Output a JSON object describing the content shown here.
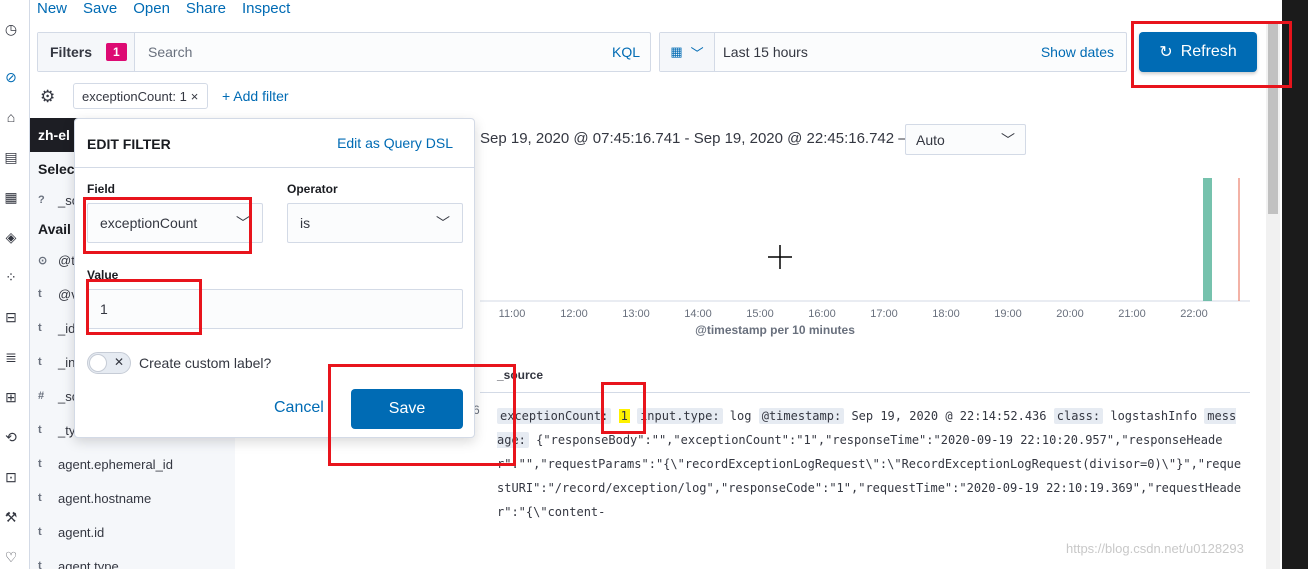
{
  "top_menu": [
    "New",
    "Save",
    "Open",
    "Share",
    "Inspect"
  ],
  "query_bar": {
    "filters_label": "Filters",
    "filter_count": "1",
    "search_placeholder": "Search",
    "language": "KQL"
  },
  "date_picker": {
    "range": "Last 15 hours",
    "show_dates": "Show dates"
  },
  "refresh_label": "Refresh",
  "filter_bar": {
    "pill_label": "exceptionCount: 1",
    "add_filter": "+ Add filter"
  },
  "sidebar": {
    "index_pattern": "zh-el",
    "selected_heading": "Selec",
    "available_heading": "Avail",
    "fields": [
      {
        "type": "?",
        "name": "_sc"
      },
      {
        "type": "⊙",
        "name": "@t"
      },
      {
        "type": "t",
        "name": "@v"
      },
      {
        "type": "t",
        "name": "_id"
      },
      {
        "type": "t",
        "name": "_in"
      },
      {
        "type": "#",
        "name": "_sc"
      },
      {
        "type": "t",
        "name": "_ty"
      },
      {
        "type": "t",
        "name": "agent.ephemeral_id"
      },
      {
        "type": "t",
        "name": "agent.hostname"
      },
      {
        "type": "t",
        "name": "agent.id"
      },
      {
        "type": "t",
        "name": "agent.type"
      }
    ]
  },
  "histogram": {
    "interval_text": "Sep 19, 2020 @ 07:45:16.741 - Sep 19, 2020 @ 22:45:16.742 —",
    "interval_value": "Auto",
    "x_ticks": [
      "11:00",
      "12:00",
      "13:00",
      "14:00",
      "15:00",
      "16:00",
      "17:00",
      "18:00",
      "19:00",
      "20:00",
      "21:00",
      "22:00"
    ],
    "x_label": "@timestamp per 10 minutes",
    "bar_color": "#54b399"
  },
  "documents": {
    "source_header": "_source",
    "row_index": "6",
    "fields": {
      "exceptionCount_key": "exceptionCount:",
      "exceptionCount_val": "1",
      "input_type_key": "input.type:",
      "input_type_val": "log",
      "timestamp_key": "@timestamp:",
      "timestamp_val": "Sep 19, 2020 @ 22:14:52.436",
      "class_key": "class:",
      "class_val": "logstashInfo",
      "message_key": "message:",
      "message_val": "{\"responseBody\":\"\",\"exceptionCount\":\"1\",\"responseTime\":\"2020-09-19 22:10:20.957\",\"responseHeader\":\"\",\"requestParams\":\"{\\\"recordExceptionLogRequest\\\":\\\"RecordExceptionLogRequest(divisor=0)\\\"}\",\"requestURI\":\"/record/exception/log\",\"responseCode\":\"1\",\"requestTime\":\"2020-09-19 22:10:19.369\",\"requestHeader\":\"{\\\"content-"
    }
  },
  "edit_filter": {
    "title": "EDIT FILTER",
    "edit_dsl": "Edit as Query DSL",
    "field_label": "Field",
    "field_value": "exceptionCount",
    "operator_label": "Operator",
    "operator_value": "is",
    "value_label": "Value",
    "value": "1",
    "custom_label": "Create custom label?",
    "cancel": "Cancel",
    "save": "Save"
  },
  "watermark": "https://blog.csdn.net/u0128293"
}
